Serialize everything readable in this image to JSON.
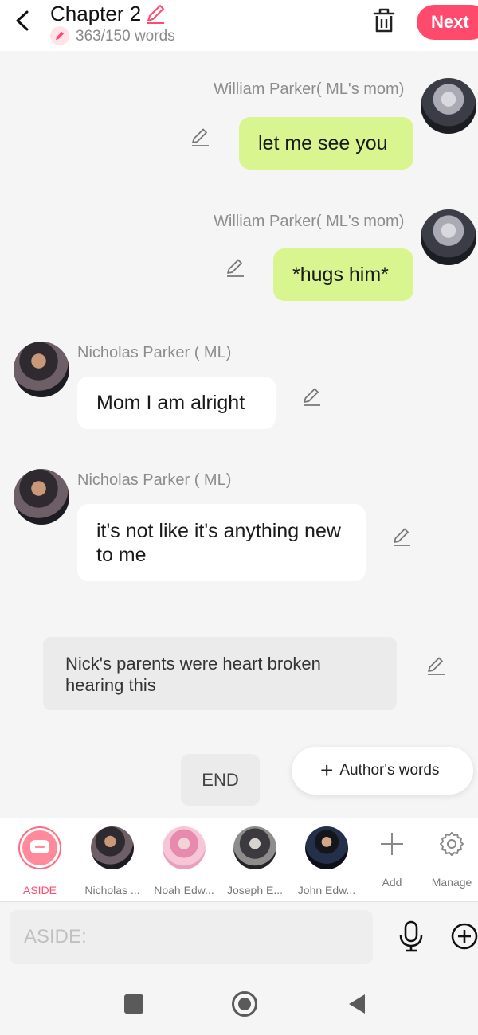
{
  "header": {
    "chapter_title": "Chapter 2",
    "word_count": "363/150 words",
    "next_label": "Next"
  },
  "messages": [
    {
      "speaker": "William Parker( ML's mom)",
      "text": "let me see you",
      "side": "right",
      "style": "green"
    },
    {
      "speaker": "William Parker( ML's mom)",
      "text": "*hugs him*",
      "side": "right",
      "style": "green"
    },
    {
      "speaker": "Nicholas Parker ( ML)",
      "text": "Mom I am alright",
      "side": "left",
      "style": "white"
    },
    {
      "speaker": "Nicholas Parker ( ML)",
      "text": "it's not like it's anything new to me",
      "side": "left",
      "style": "white"
    },
    {
      "speaker": "",
      "text": "Nick's parents were heart broken hearing this",
      "side": "center",
      "style": "aside"
    }
  ],
  "end_label": "END",
  "author_words_label": "Author's words",
  "character_bar": {
    "aside_label": "ASIDE",
    "characters": [
      {
        "label": "Nicholas ..."
      },
      {
        "label": "Noah Edw..."
      },
      {
        "label": "Joseph E..."
      },
      {
        "label": "John Edw..."
      }
    ],
    "add_label": "Add",
    "manage_label": "Manage"
  },
  "input": {
    "placeholder": "ASIDE:"
  },
  "colors": {
    "accent": "#ff4a6e",
    "bubble_green": "#d8f58f",
    "aside_active": "#ff6b83"
  }
}
